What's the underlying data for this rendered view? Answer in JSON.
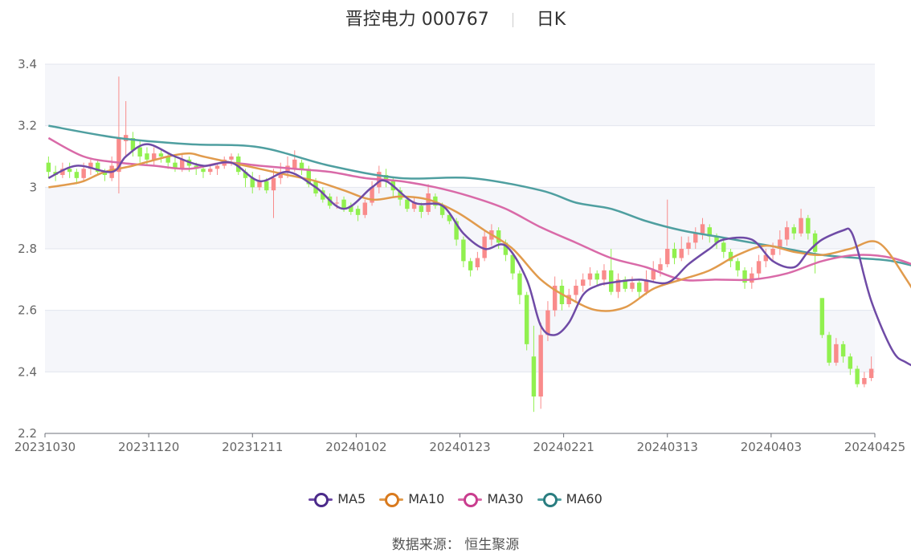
{
  "header": {
    "title": "晋控电力 000767",
    "period": "日K"
  },
  "source": {
    "label": "数据来源：",
    "value": "恒生聚源"
  },
  "colors": {
    "up": "#f98b8b",
    "down": "#91f04f",
    "MA5": "#6f4ba6",
    "MA10": "#e19b4d",
    "MA30": "#d96aa8",
    "MA60": "#4f9fa0"
  },
  "chart_data": {
    "type": "candlestick",
    "ylim": [
      2.2,
      3.4
    ],
    "yticks": [
      2.2,
      2.4,
      2.6,
      2.8,
      3,
      3.2,
      3.4
    ],
    "xticks": [
      "20231030",
      "20231120",
      "20231211",
      "20240102",
      "20240123",
      "20240221",
      "20240313",
      "20240403",
      "20240425"
    ],
    "legend": [
      "MA5",
      "MA10",
      "MA30",
      "MA60"
    ],
    "candles": [
      [
        3.08,
        3.05,
        3.1,
        3.03
      ],
      [
        3.05,
        3.04,
        3.07,
        3.02
      ],
      [
        3.04,
        3.06,
        3.08,
        3.03
      ],
      [
        3.06,
        3.05,
        3.08,
        3.03
      ],
      [
        3.05,
        3.03,
        3.06,
        3.01
      ],
      [
        3.03,
        3.06,
        3.08,
        3.02
      ],
      [
        3.06,
        3.08,
        3.09,
        3.04
      ],
      [
        3.08,
        3.05,
        3.09,
        3.04
      ],
      [
        3.05,
        3.04,
        3.06,
        3.02
      ],
      [
        3.03,
        3.07,
        3.1,
        3.02
      ],
      [
        3.05,
        3.16,
        3.36,
        2.98
      ],
      [
        3.15,
        3.17,
        3.28,
        3.1
      ],
      [
        3.16,
        3.12,
        3.18,
        3.1
      ],
      [
        3.13,
        3.1,
        3.15,
        3.08
      ],
      [
        3.11,
        3.09,
        3.13,
        3.07
      ],
      [
        3.09,
        3.11,
        3.13,
        3.07
      ],
      [
        3.11,
        3.1,
        3.12,
        3.08
      ],
      [
        3.1,
        3.08,
        3.11,
        3.06
      ],
      [
        3.08,
        3.06,
        3.1,
        3.05
      ],
      [
        3.06,
        3.09,
        3.11,
        3.05
      ],
      [
        3.09,
        3.07,
        3.1,
        3.05
      ],
      [
        3.07,
        3.06,
        3.08,
        3.04
      ],
      [
        3.06,
        3.05,
        3.07,
        3.03
      ],
      [
        3.05,
        3.06,
        3.07,
        3.04
      ],
      [
        3.06,
        3.07,
        3.08,
        3.04
      ],
      [
        3.07,
        3.09,
        3.1,
        3.06
      ],
      [
        3.09,
        3.1,
        3.11,
        3.07
      ],
      [
        3.1,
        3.05,
        3.11,
        3.04
      ],
      [
        3.05,
        3.03,
        3.06,
        3.0
      ],
      [
        3.03,
        3.0,
        3.05,
        2.98
      ],
      [
        3.0,
        3.02,
        3.04,
        2.99
      ],
      [
        3.02,
        2.99,
        3.03,
        2.98
      ],
      [
        2.99,
        3.03,
        3.06,
        2.9
      ],
      [
        3.03,
        3.05,
        3.08,
        3.01
      ],
      [
        3.05,
        3.07,
        3.1,
        3.03
      ],
      [
        3.06,
        3.09,
        3.12,
        3.05
      ],
      [
        3.08,
        3.06,
        3.09,
        3.04
      ],
      [
        3.06,
        3.01,
        3.07,
        3.0
      ],
      [
        3.02,
        2.98,
        3.03,
        2.97
      ],
      [
        2.99,
        2.96,
        3.0,
        2.95
      ],
      [
        2.97,
        2.94,
        2.98,
        2.93
      ],
      [
        2.95,
        2.95,
        2.97,
        2.93
      ],
      [
        2.96,
        2.93,
        2.97,
        2.92
      ],
      [
        2.94,
        2.92,
        2.95,
        2.91
      ],
      [
        2.93,
        2.91,
        2.94,
        2.89
      ],
      [
        2.91,
        2.95,
        2.96,
        2.9
      ],
      [
        2.95,
        3.0,
        3.02,
        2.94
      ],
      [
        3.0,
        3.05,
        3.07,
        2.98
      ],
      [
        3.04,
        3.02,
        3.06,
        3.0
      ],
      [
        3.02,
        2.99,
        3.03,
        2.97
      ],
      [
        2.99,
        2.96,
        3.0,
        2.94
      ],
      [
        2.96,
        2.93,
        2.97,
        2.92
      ],
      [
        2.93,
        2.95,
        2.97,
        2.92
      ],
      [
        2.94,
        2.92,
        2.95,
        2.9
      ],
      [
        2.92,
        2.98,
        3.01,
        2.91
      ],
      [
        2.97,
        2.94,
        2.98,
        2.93
      ],
      [
        2.94,
        2.91,
        2.95,
        2.9
      ],
      [
        2.91,
        2.89,
        2.92,
        2.88
      ],
      [
        2.89,
        2.83,
        2.9,
        2.81
      ],
      [
        2.83,
        2.76,
        2.84,
        2.74
      ],
      [
        2.76,
        2.73,
        2.77,
        2.71
      ],
      [
        2.74,
        2.77,
        2.79,
        2.73
      ],
      [
        2.77,
        2.84,
        2.86,
        2.76
      ],
      [
        2.83,
        2.86,
        2.88,
        2.81
      ],
      [
        2.86,
        2.82,
        2.87,
        2.8
      ],
      [
        2.82,
        2.78,
        2.83,
        2.76
      ],
      [
        2.78,
        2.72,
        2.79,
        2.7
      ],
      [
        2.72,
        2.65,
        2.73,
        2.62
      ],
      [
        2.65,
        2.49,
        2.66,
        2.47
      ],
      [
        2.45,
        2.32,
        2.55,
        2.27
      ],
      [
        2.32,
        2.52,
        2.56,
        2.28
      ],
      [
        2.52,
        2.6,
        2.63,
        2.5
      ],
      [
        2.6,
        2.68,
        2.71,
        2.58
      ],
      [
        2.68,
        2.62,
        2.7,
        2.6
      ],
      [
        2.62,
        2.65,
        2.67,
        2.61
      ],
      [
        2.65,
        2.68,
        2.7,
        2.63
      ],
      [
        2.68,
        2.7,
        2.72,
        2.66
      ],
      [
        2.7,
        2.72,
        2.74,
        2.68
      ],
      [
        2.72,
        2.7,
        2.73,
        2.68
      ],
      [
        2.7,
        2.73,
        2.75,
        2.68
      ],
      [
        2.73,
        2.66,
        2.8,
        2.65
      ],
      [
        2.66,
        2.7,
        2.72,
        2.64
      ],
      [
        2.7,
        2.67,
        2.71,
        2.66
      ],
      [
        2.67,
        2.69,
        2.71,
        2.66
      ],
      [
        2.69,
        2.66,
        2.7,
        2.64
      ],
      [
        2.66,
        2.7,
        2.73,
        2.65
      ],
      [
        2.7,
        2.73,
        2.76,
        2.69
      ],
      [
        2.73,
        2.75,
        2.77,
        2.71
      ],
      [
        2.75,
        2.8,
        2.96,
        2.74
      ],
      [
        2.8,
        2.77,
        2.82,
        2.75
      ],
      [
        2.77,
        2.8,
        2.84,
        2.76
      ],
      [
        2.8,
        2.82,
        2.84,
        2.78
      ],
      [
        2.82,
        2.85,
        2.87,
        2.8
      ],
      [
        2.85,
        2.88,
        2.9,
        2.83
      ],
      [
        2.87,
        2.84,
        2.88,
        2.82
      ],
      [
        2.84,
        2.82,
        2.85,
        2.8
      ],
      [
        2.82,
        2.79,
        2.83,
        2.77
      ],
      [
        2.79,
        2.76,
        2.8,
        2.74
      ],
      [
        2.76,
        2.73,
        2.77,
        2.71
      ],
      [
        2.73,
        2.69,
        2.74,
        2.67
      ],
      [
        2.69,
        2.72,
        2.74,
        2.67
      ],
      [
        2.72,
        2.76,
        2.78,
        2.7
      ],
      [
        2.76,
        2.78,
        2.8,
        2.74
      ],
      [
        2.78,
        2.8,
        2.82,
        2.76
      ],
      [
        2.8,
        2.83,
        2.86,
        2.78
      ],
      [
        2.83,
        2.87,
        2.89,
        2.81
      ],
      [
        2.87,
        2.85,
        2.88,
        2.83
      ],
      [
        2.85,
        2.9,
        2.93,
        2.84
      ],
      [
        2.9,
        2.85,
        2.91,
        2.83
      ],
      [
        2.85,
        2.79,
        2.86,
        2.72
      ],
      [
        2.64,
        2.52,
        2.64,
        2.51
      ],
      [
        2.52,
        2.43,
        2.53,
        2.42
      ],
      [
        2.43,
        2.49,
        2.51,
        2.42
      ],
      [
        2.49,
        2.45,
        2.5,
        2.43
      ],
      [
        2.45,
        2.41,
        2.46,
        2.39
      ],
      [
        2.41,
        2.36,
        2.42,
        2.35
      ],
      [
        2.36,
        2.38,
        2.4,
        2.35
      ],
      [
        2.38,
        2.41,
        2.45,
        2.37
      ]
    ],
    "ma": {
      "MA5": [
        [
          0,
          3.03
        ],
        [
          4,
          3.07
        ],
        [
          9,
          3.05
        ],
        [
          11,
          3.1
        ],
        [
          14,
          3.14
        ],
        [
          18,
          3.1
        ],
        [
          22,
          3.07
        ],
        [
          26,
          3.08
        ],
        [
          30,
          3.02
        ],
        [
          34,
          3.05
        ],
        [
          38,
          3.0
        ],
        [
          42,
          2.93
        ],
        [
          46,
          3.0
        ],
        [
          48,
          3.02
        ],
        [
          52,
          2.95
        ],
        [
          56,
          2.94
        ],
        [
          59,
          2.85
        ],
        [
          62,
          2.8
        ],
        [
          65,
          2.81
        ],
        [
          68,
          2.7
        ],
        [
          70,
          2.55
        ],
        [
          72,
          2.52
        ],
        [
          74,
          2.56
        ],
        [
          76,
          2.65
        ],
        [
          78,
          2.68
        ],
        [
          80,
          2.69
        ],
        [
          84,
          2.7
        ],
        [
          88,
          2.69
        ],
        [
          91,
          2.75
        ],
        [
          94,
          2.8
        ],
        [
          96,
          2.83
        ],
        [
          100,
          2.83
        ],
        [
          103,
          2.76
        ],
        [
          106,
          2.74
        ],
        [
          108,
          2.79
        ],
        [
          110,
          2.83
        ],
        [
          113,
          2.86
        ],
        [
          114,
          2.86
        ],
        [
          115,
          2.8
        ],
        [
          117,
          2.63
        ],
        [
          120,
          2.47
        ],
        [
          122,
          2.43
        ],
        [
          125,
          2.4
        ],
        [
          127,
          2.39
        ]
      ],
      "MA10": [
        [
          0,
          3.0
        ],
        [
          3,
          3.01
        ],
        [
          5,
          3.02
        ],
        [
          8,
          3.05
        ],
        [
          12,
          3.07
        ],
        [
          17,
          3.1
        ],
        [
          20,
          3.11
        ],
        [
          22,
          3.1
        ],
        [
          26,
          3.08
        ],
        [
          30,
          3.06
        ],
        [
          34,
          3.04
        ],
        [
          38,
          3.02
        ],
        [
          42,
          2.99
        ],
        [
          46,
          2.96
        ],
        [
          50,
          2.97
        ],
        [
          54,
          2.96
        ],
        [
          58,
          2.92
        ],
        [
          62,
          2.86
        ],
        [
          66,
          2.8
        ],
        [
          70,
          2.7
        ],
        [
          74,
          2.64
        ],
        [
          78,
          2.6
        ],
        [
          82,
          2.61
        ],
        [
          86,
          2.67
        ],
        [
          90,
          2.7
        ],
        [
          94,
          2.73
        ],
        [
          98,
          2.78
        ],
        [
          102,
          2.81
        ],
        [
          106,
          2.79
        ],
        [
          110,
          2.78
        ],
        [
          114,
          2.8
        ],
        [
          118,
          2.82
        ],
        [
          122,
          2.7
        ],
        [
          127,
          2.51
        ]
      ],
      "MA30": [
        [
          0,
          3.16
        ],
        [
          5,
          3.1
        ],
        [
          10,
          3.08
        ],
        [
          15,
          3.07
        ],
        [
          20,
          3.06
        ],
        [
          25,
          3.08
        ],
        [
          30,
          3.07
        ],
        [
          35,
          3.06
        ],
        [
          40,
          3.05
        ],
        [
          45,
          3.03
        ],
        [
          50,
          3.02
        ],
        [
          55,
          3.0
        ],
        [
          60,
          2.97
        ],
        [
          65,
          2.93
        ],
        [
          70,
          2.87
        ],
        [
          75,
          2.82
        ],
        [
          80,
          2.77
        ],
        [
          85,
          2.74
        ],
        [
          90,
          2.7
        ],
        [
          95,
          2.7
        ],
        [
          100,
          2.7
        ],
        [
          105,
          2.72
        ],
        [
          110,
          2.76
        ],
        [
          115,
          2.78
        ],
        [
          120,
          2.77
        ],
        [
          125,
          2.73
        ],
        [
          127,
          2.71
        ]
      ],
      "MA60": [
        [
          0,
          3.2
        ],
        [
          10,
          3.16
        ],
        [
          20,
          3.14
        ],
        [
          30,
          3.13
        ],
        [
          40,
          3.07
        ],
        [
          50,
          3.03
        ],
        [
          60,
          3.03
        ],
        [
          70,
          2.99
        ],
        [
          75,
          2.95
        ],
        [
          80,
          2.93
        ],
        [
          85,
          2.89
        ],
        [
          90,
          2.86
        ],
        [
          95,
          2.84
        ],
        [
          100,
          2.82
        ],
        [
          105,
          2.8
        ],
        [
          110,
          2.78
        ],
        [
          115,
          2.77
        ],
        [
          120,
          2.76
        ],
        [
          125,
          2.73
        ],
        [
          127,
          2.7
        ]
      ]
    }
  }
}
